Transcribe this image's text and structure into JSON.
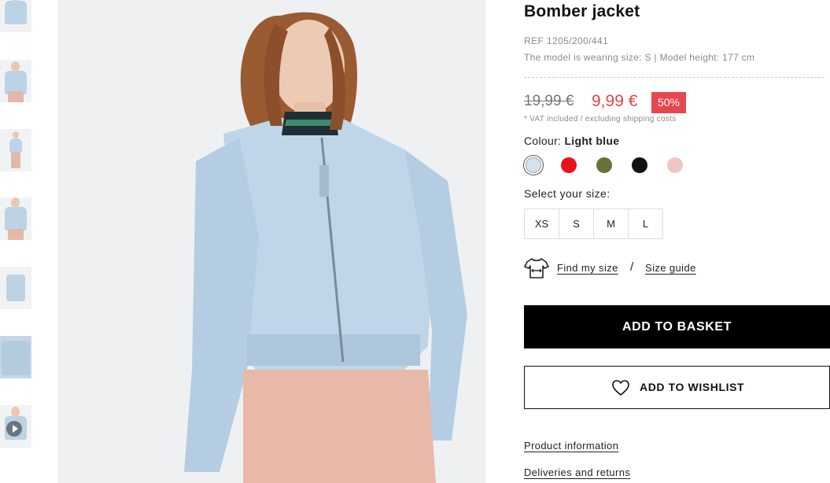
{
  "product": {
    "title": "Bomber jacket",
    "ref": "REF 1205/200/441",
    "model_info": "The model is wearing size: S | Model height: 177 cm"
  },
  "pricing": {
    "old_price": "19,99 €",
    "new_price": "9,99 €",
    "discount_badge": "50%",
    "vat_note": "* VAT included / excluding shipping costs"
  },
  "colour": {
    "label": "Colour:",
    "selected": "Light blue",
    "swatches": [
      {
        "name": "light-blue",
        "hex": "#d6e2ea",
        "selected": true
      },
      {
        "name": "red",
        "hex": "#e8121c",
        "selected": false
      },
      {
        "name": "olive",
        "hex": "#6b7139",
        "selected": false
      },
      {
        "name": "black",
        "hex": "#111111",
        "selected": false
      },
      {
        "name": "pink",
        "hex": "#ecc8c2",
        "selected": false
      }
    ]
  },
  "size": {
    "label": "Select your size:",
    "options": [
      "XS",
      "S",
      "M",
      "L"
    ],
    "find_my_size": "Find my size",
    "separator": "/",
    "size_guide": "Size guide",
    "icon": "tshirt-measure-icon"
  },
  "actions": {
    "add_to_basket": "ADD TO BASKET",
    "add_to_wishlist": "ADD TO WISHLIST",
    "wishlist_icon": "heart-icon"
  },
  "links": {
    "product_information": "Product information",
    "deliveries_and_returns": "Deliveries and returns"
  },
  "gallery": {
    "thumbnails": 7,
    "active_thumbnail": 4,
    "last_thumbnail_icon": "play-icon"
  },
  "colors": {
    "accent_red": "#e4434b",
    "button_black": "#000000"
  }
}
